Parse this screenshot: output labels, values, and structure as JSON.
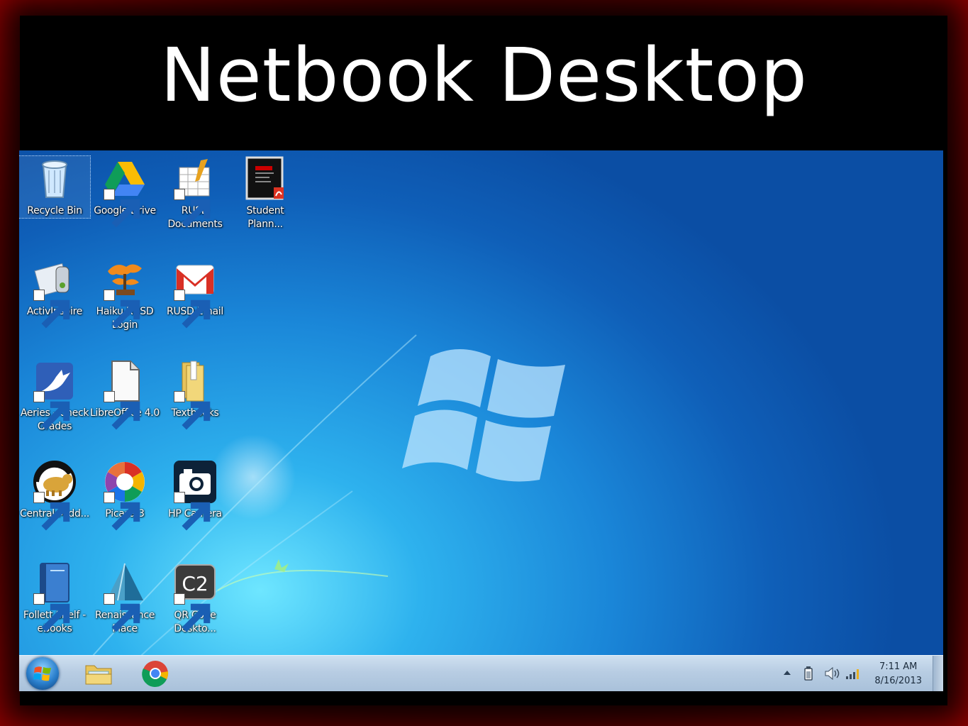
{
  "slide": {
    "title": "Netbook Desktop"
  },
  "desktop": {
    "icons": [
      {
        "label": "Recycle Bin",
        "icon": "recycle-bin-icon"
      },
      {
        "label": "Google Drive",
        "icon": "google-drive-icon"
      },
      {
        "label": "RUSD Documents",
        "icon": "rusd-documents-icon"
      },
      {
        "label": "Student Plann...",
        "icon": "pdf-document-icon"
      },
      {
        "label": "ActivInspire",
        "icon": "activinspire-icon"
      },
      {
        "label": "Haiku RUSD Login",
        "icon": "bonsai-tree-icon"
      },
      {
        "label": "RUSD Email",
        "icon": "gmail-icon"
      },
      {
        "label": "Aeries - Check Grades",
        "icon": "aeries-bird-icon"
      },
      {
        "label": "LibreOffice 4.0",
        "icon": "libreoffice-icon"
      },
      {
        "label": "Textbooks",
        "icon": "folder-icon"
      },
      {
        "label": "Central Midd...",
        "icon": "bear-logo-icon"
      },
      {
        "label": "Picasa 3",
        "icon": "picasa-icon"
      },
      {
        "label": "HP Camera",
        "icon": "camera-icon"
      },
      {
        "label": "Follett Shelf - eBooks",
        "icon": "book-icon"
      },
      {
        "label": "Renaissance Place",
        "icon": "pyramid-icon"
      },
      {
        "label": "QR Code Deskto...",
        "icon": "c2-qr-icon"
      }
    ]
  },
  "taskbar": {
    "start_icon": "windows-start-icon",
    "pinned": [
      "explorer-folder-icon",
      "chrome-icon"
    ],
    "tray_icons": [
      "show-hidden-icons-arrow",
      "battery-icon",
      "volume-icon",
      "network-signal-icon"
    ],
    "clock": {
      "time": "7:11 AM",
      "date": "8/16/2013"
    }
  },
  "colors": {
    "frame": "#7a0000",
    "desktop_blue": "#1a86d8",
    "taskbar": "#b8cde3"
  }
}
